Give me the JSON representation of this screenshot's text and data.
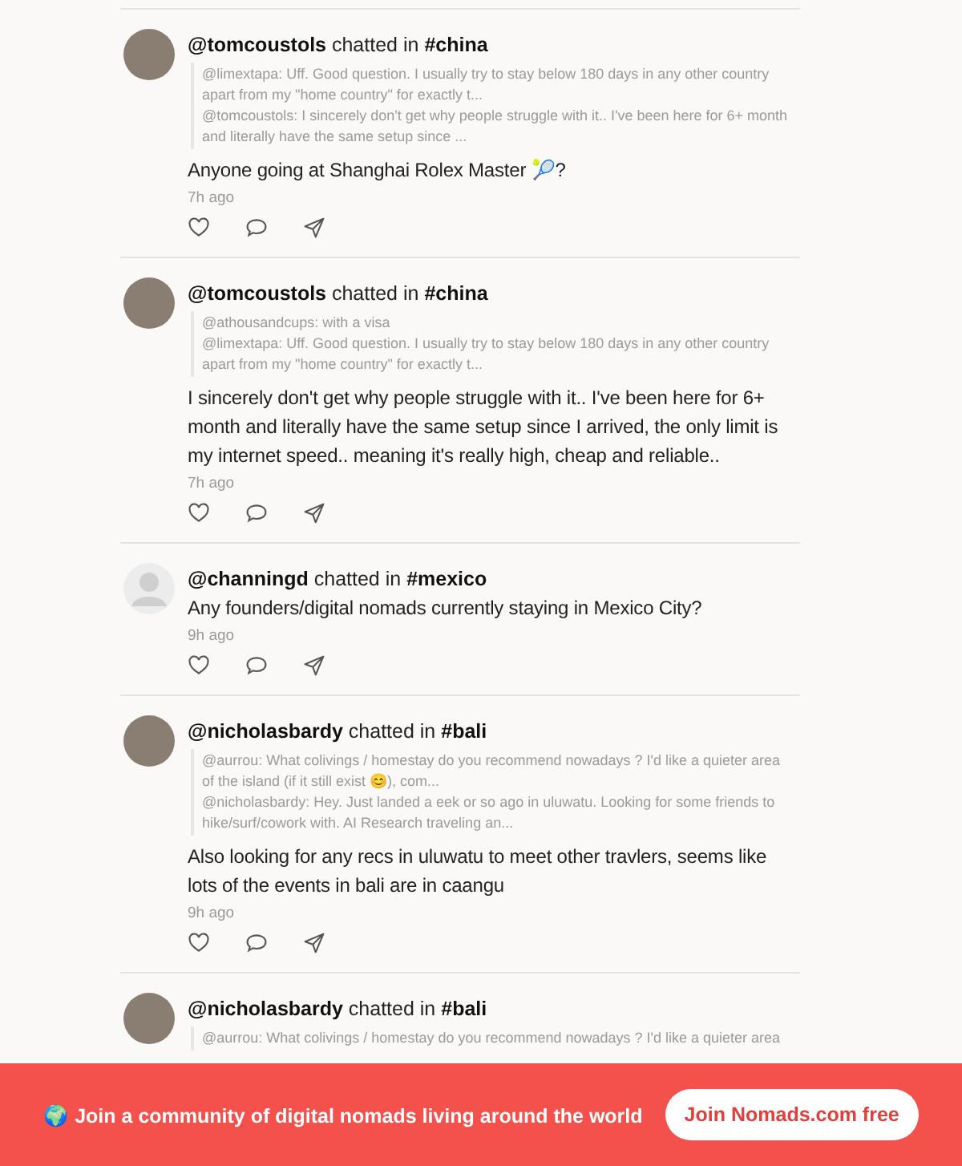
{
  "posts": [
    {
      "avatar": {
        "kind": "photo"
      },
      "user": "@tomcoustols",
      "verb": "chatted in",
      "channel": "#china",
      "quotes": [
        "@limextapa: Uff. Good question. I usually try to stay below 180 days in any other country apart from my \"home country\" for exactly t...",
        "@tomcoustols: I sincerely don't get why people struggle with it.. I've been here for 6+ month and literally have the same setup since ..."
      ],
      "message": "Anyone going at Shanghai Rolex Master 🎾?",
      "time": "7h ago"
    },
    {
      "avatar": {
        "kind": "photo"
      },
      "user": "@tomcoustols",
      "verb": "chatted in",
      "channel": "#china",
      "quotes": [
        "@athousandcups: with a visa",
        "@limextapa: Uff. Good question. I usually try to stay below 180 days in any other country apart from my \"home country\" for exactly t..."
      ],
      "message": "I sincerely don't get why people struggle with it.. I've been here for 6+ month and literally have the same setup since I arrived, the only limit is my internet speed.. meaning it's really high, cheap and reliable..",
      "time": "7h ago"
    },
    {
      "avatar": {
        "kind": "silhouette"
      },
      "user": "@channingd",
      "verb": "chatted in",
      "channel": "#mexico",
      "message": "Any founders/digital nomads currently staying in Mexico City?",
      "time": "9h ago"
    },
    {
      "avatar": {
        "kind": "photo"
      },
      "user": "@nicholasbardy",
      "verb": "chatted in",
      "channel": "#bali",
      "quotes": [
        "@aurrou: What colivings / homestay do you recommend nowadays ? I'd like a quieter area of the island (if it still exist 😊), com...",
        "@nicholasbardy: Hey. Just landed a eek or so ago in uluwatu. Looking for some friends to hike/surf/cowork with. AI Research traveling an..."
      ],
      "message": "Also looking for any recs in uluwatu to meet other travlers, seems like lots of the events in bali are in caangu",
      "time": "9h ago"
    },
    {
      "avatar": {
        "kind": "photo"
      },
      "user": "@nicholasbardy",
      "verb": "chatted in",
      "channel": "#bali",
      "quotes": [
        "@aurrou: What colivings / homestay do you recommend nowadays ? I'd like a quieter area"
      ]
    }
  ],
  "banner": {
    "text": "🌍 Join a community of digital nomads living around the world",
    "button": "Join Nomads.com free"
  }
}
